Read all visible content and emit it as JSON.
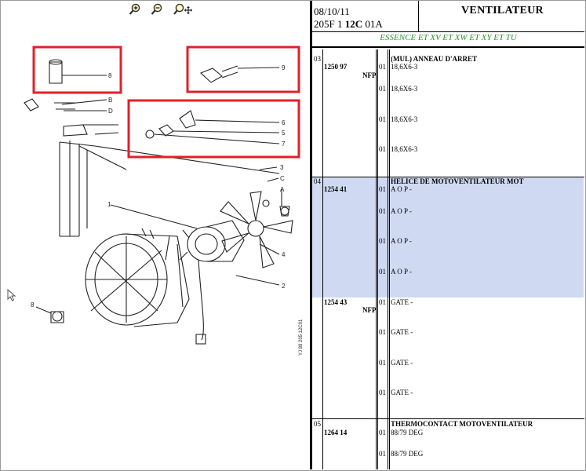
{
  "toolbar": {
    "zoom_in_icon": "zoom-in",
    "zoom_out_icon": "zoom-out",
    "pan_icon": "zoom-move"
  },
  "diagram": {
    "callouts": [
      "8",
      "9",
      "6",
      "5",
      "7",
      "3",
      "C",
      "A",
      "1",
      "4",
      "2",
      "B",
      "D"
    ],
    "stamp": "YJ 89 205 12C01",
    "highlight_color": "#e0202a"
  },
  "header": {
    "date": "08/10/11",
    "ref_prefix": "205F 1 ",
    "ref_bold": "12C",
    "ref_suffix": " 01A",
    "title": "VENTILATEUR",
    "engine": "ESSENCE ET XV ET XW ET XY ET TU"
  },
  "sections": [
    {
      "num": "03",
      "ref": "1250 97",
      "nfp": "NFP",
      "designation": "(MUL) ANNEAU D'ARRET",
      "lines": [
        {
          "qty": "01",
          "text": "18,6X6-3"
        },
        {
          "qty": "01",
          "text": "18,6X6-3"
        },
        {
          "qty": "01",
          "text": "18,6X6-3"
        },
        {
          "qty": "01",
          "text": "18,6X6-3"
        }
      ]
    },
    {
      "num": "04",
      "ref": "1254 41",
      "nfp": "",
      "designation": "HELICE DE MOTOVENTILATEUR MOT",
      "lines": [
        {
          "qty": "01",
          "text": "A O P -"
        },
        {
          "qty": "01",
          "text": "A O P -"
        },
        {
          "qty": "01",
          "text": "A O P -"
        },
        {
          "qty": "01",
          "text": "A O P -"
        }
      ]
    },
    {
      "num": "",
      "ref": "1254 43",
      "nfp": "NFP",
      "designation": "",
      "lines": [
        {
          "qty": "01",
          "text": "GATE -"
        },
        {
          "qty": "01",
          "text": "GATE -"
        },
        {
          "qty": "01",
          "text": "GATE -"
        },
        {
          "qty": "01",
          "text": "GATE -"
        }
      ]
    },
    {
      "num": "05",
      "ref": "1264 14",
      "nfp": "",
      "designation": "THERMOCONTACT MOTOVENTILATEUR",
      "lines": [
        {
          "qty": "01",
          "text": "88/79 DEG"
        },
        {
          "qty": "01",
          "text": "88/79 DEG"
        }
      ]
    }
  ],
  "colors": {
    "engine_text": "#2f9a2f",
    "selected_row": "#cfdaf2"
  }
}
